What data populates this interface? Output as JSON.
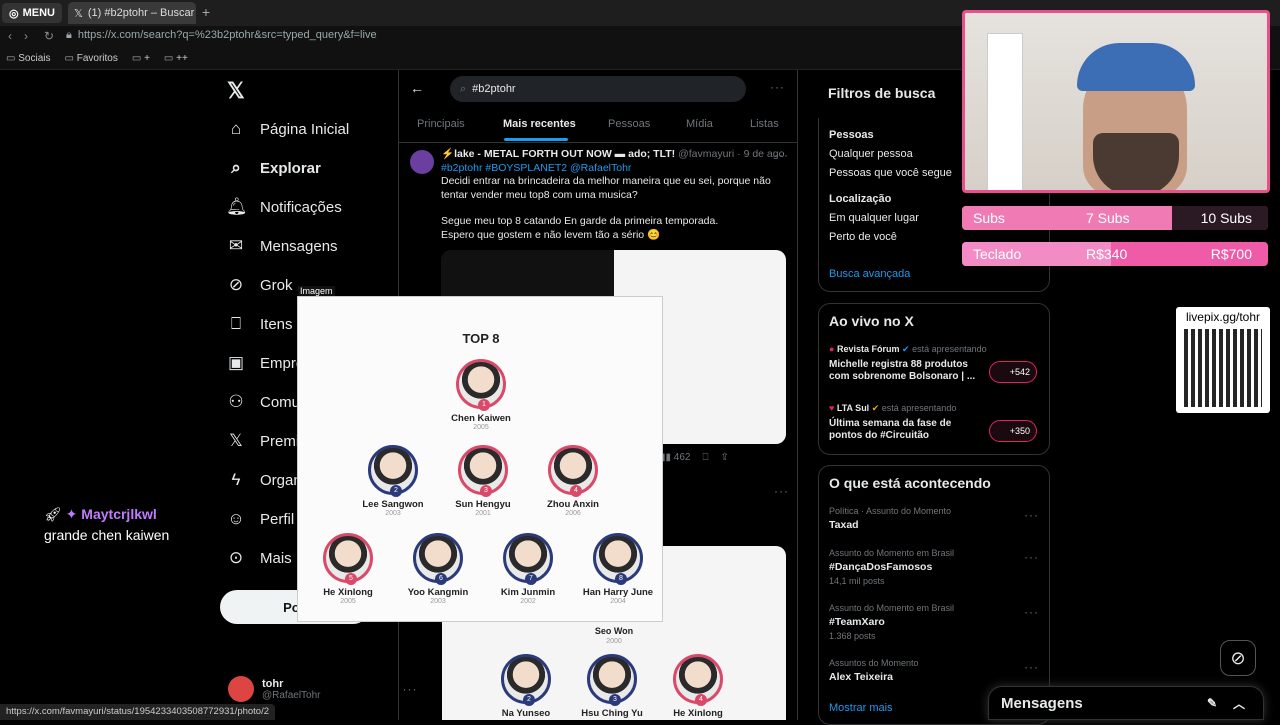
{
  "browser": {
    "menu_label": "MENU",
    "tab_title": "(1) #b2ptohr – Buscar / X",
    "url": "https://x.com/search?q=%23b2ptohr&src=typed_query&f=live",
    "bookmarks": [
      "Sociais",
      "Favoritos",
      "+",
      "++"
    ],
    "status_url": "https://x.com/favmayuri/status/1954233403508772931/photo/2"
  },
  "nav": {
    "items": [
      "Página Inicial",
      "Explorar",
      "Notificações",
      "Mensagens",
      "Grok",
      "Itens s",
      "Empre",
      "Comu",
      "Premiu",
      "Organ",
      "Perfil",
      "Mais"
    ],
    "post_label": "Pos",
    "account_name": "tohr",
    "account_handle": "@RafaelTohr"
  },
  "search": {
    "query": "#b2ptohr",
    "tabs": [
      "Principais",
      "Mais recentes",
      "Pessoas",
      "Mídia",
      "Listas"
    ]
  },
  "tweet": {
    "author": "⚡lake - METAL FORTH OUT NOW ▬ ado; TLT!",
    "handle": "@favmayuri · 9 de ago",
    "hashtags": "#b2ptohr #BOYSPLANET2 @RafaelTohr",
    "text1": "Decidi entrar na brincadeira da melhor maneira que eu sei, porque não tentar vender meu top8 com uma musica?",
    "text2": "Segue meu top 8 catando En garde da primeira temporada.",
    "text3": "Espero que gostem e não levem tão a sério 😊",
    "views": "462"
  },
  "popup": {
    "label": "Imagem",
    "title": "TOP 8",
    "members": [
      {
        "rank": "1",
        "name": "Chen Kaiwen",
        "year": "2005",
        "color": "pink"
      },
      {
        "rank": "2",
        "name": "Lee Sangwon",
        "year": "2003",
        "color": "blue"
      },
      {
        "rank": "3",
        "name": "Sun Hengyu",
        "year": "2001",
        "color": "pink"
      },
      {
        "rank": "4",
        "name": "Zhou Anxin",
        "year": "2006",
        "color": "pink"
      },
      {
        "rank": "5",
        "name": "He Xinlong",
        "year": "2005",
        "color": "pink"
      },
      {
        "rank": "6",
        "name": "Yoo Kangmin",
        "year": "2003",
        "color": "blue"
      },
      {
        "rank": "7",
        "name": "Kim Junmin",
        "year": "2002",
        "color": "blue"
      },
      {
        "rank": "8",
        "name": "Han Harry June",
        "year": "2004",
        "color": "blue"
      }
    ]
  },
  "tweet2": {
    "top_name": "Seo Won",
    "top_year": "2000",
    "members": [
      {
        "rank": "2",
        "name": "Na Yunseo",
        "color": "blue"
      },
      {
        "rank": "3",
        "name": "Hsu Ching Yu",
        "color": "blue"
      },
      {
        "rank": "4",
        "name": "He Xinlong",
        "color": "pink"
      }
    ]
  },
  "filters": {
    "title": "Filtros de busca",
    "people_heading": "Pessoas",
    "people_options": [
      "Qualquer pessoa",
      "Pessoas que você segue"
    ],
    "location_heading": "Localização",
    "location_options": [
      "Em qualquer lugar",
      "Perto de você"
    ],
    "advanced": "Busca avançada"
  },
  "live": {
    "title": "Ao vivo no X",
    "items": [
      {
        "source": "Revista Fórum",
        "status": "está apresentando",
        "headline": "Michelle registra 88 produtos com sobrenome Bolsonaro | ...",
        "count": "+542"
      },
      {
        "source": "LTA Sul",
        "status": "está apresentando",
        "headline": "Última semana da fase de pontos do #Circuitão",
        "count": "+350"
      }
    ]
  },
  "trends": {
    "title": "O que está acontecendo",
    "items": [
      {
        "context": "Política · Assunto do Momento",
        "name": "Taxad",
        "posts": ""
      },
      {
        "context": "Assunto do Momento em Brasil",
        "name": "#DançaDosFamosos",
        "posts": "14,1 mil posts"
      },
      {
        "context": "Assunto do Momento em Brasil",
        "name": "#TeamXaro",
        "posts": "1.368 posts"
      },
      {
        "context": "Assuntos do Momento",
        "name": "Alex Teixeira",
        "posts": ""
      }
    ],
    "show_more": "Mostrar mais"
  },
  "overlay": {
    "subs_label": "Subs",
    "subs_current": "7 Subs",
    "subs_goal": "10 Subs",
    "subs_progress": 0.7,
    "teclado_label": "Teclado",
    "teclado_current": "R$340",
    "teclado_goal": "R$700",
    "teclado_progress": 0.486,
    "livepix": "livepix.gg/tohr",
    "chat_user": "Maytcrjlkwl",
    "chat_message": "grande chen kaiwen"
  },
  "messages": {
    "label": "Mensagens"
  },
  "colors": {
    "accent": "#1d9bf0",
    "overlay_pink": "#e94f8c"
  }
}
